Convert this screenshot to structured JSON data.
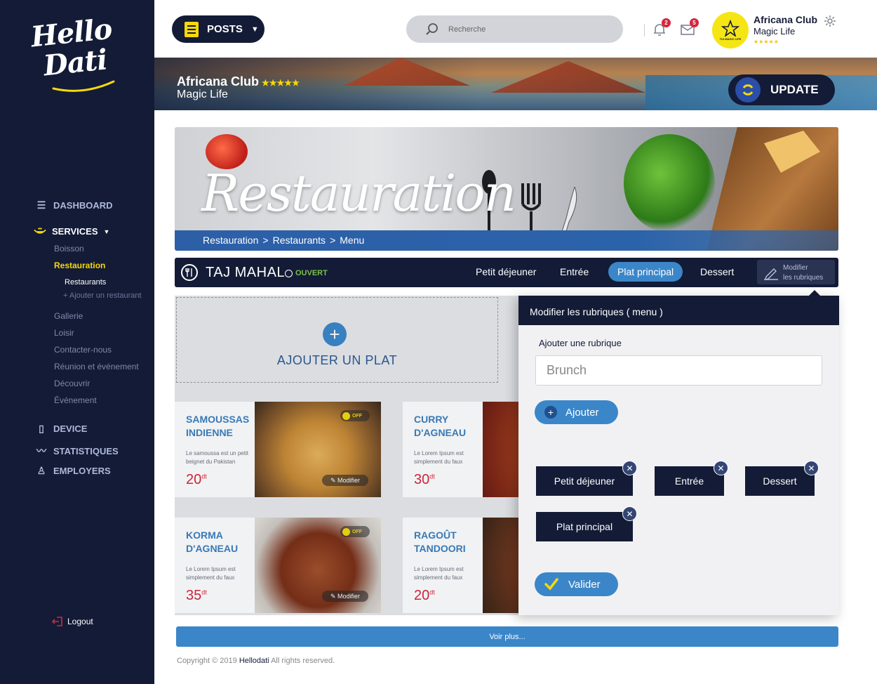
{
  "sidebar": {
    "logo_line1": "Hello",
    "logo_line2": "Dati",
    "nav": {
      "dashboard": "DASHBOARD",
      "services": "SERVICES",
      "boisson": "Boisson",
      "restauration": "Restauration",
      "restaurants": "Restaurants",
      "add_restaurant": "+ Ajouter un restaurant",
      "gallerie": "Gallerie",
      "loisir": "Loisir",
      "contact": "Contacter-nous",
      "reunion": "Réunion et événement",
      "decouvrir": "Découvrir",
      "evenement": "Événement",
      "device": "DEVICE",
      "statistiques": "STATISTIQUES",
      "employers": "EMPLOYERS"
    },
    "logout": "Logout"
  },
  "topbar": {
    "posts_label": "POSTS",
    "search_placeholder": "Recherche",
    "notifications_count": "2",
    "messages_count": "5",
    "avatar_text": "TUI MAGIC LIFE",
    "club_name": "Africana Club",
    "club_sub": "Magic Life",
    "club_stars": "★★★★★"
  },
  "hero": {
    "title": "Africana Club",
    "stars": "★★★★★",
    "subtitle": "Magic Life",
    "update_label": "UPDATE"
  },
  "banner": {
    "title": "Restauration",
    "breadcrumb": [
      "Restauration",
      ">",
      "Restaurants",
      ">",
      "Menu"
    ]
  },
  "restaurant": {
    "name": "TAJ MAHAL",
    "status": "OUVERT",
    "tabs": [
      "Petit déjeuner",
      "Entrée",
      "Plat principal",
      "Dessert"
    ],
    "active_tab": "Plat principal",
    "edit_label_1": "Modifier",
    "edit_label_2": "les rubriques"
  },
  "content": {
    "add_label": "AJOUTER UN PLAT",
    "dishes": [
      {
        "name": "SAMOUSSAS INDIENNE",
        "desc": "Le samoussa est un petit beignet du Pakistan",
        "price": "20",
        "currency": "dt",
        "badge": "OFF",
        "edit": "Modifier"
      },
      {
        "name": "CURRY D'AGNEAU",
        "desc": "Le Lorem Ipsum est simplement du faux",
        "price": "30",
        "currency": "dt"
      },
      {
        "name": "KORMA D'AGNEAU",
        "desc": "Le Lorem Ipsum est simplement du faux",
        "price": "35",
        "currency": "dt",
        "badge": "OFF",
        "edit": "Modifier"
      },
      {
        "name": "RAGOÛT TANDOORI",
        "desc": "Le Lorem Ipsum est simplement du faux",
        "price": "20",
        "currency": "dt"
      }
    ]
  },
  "panel": {
    "title": "Modifier les rubriques ( menu )",
    "add_label": "Ajouter une rubrique",
    "input_placeholder": "Brunch",
    "add_button": "Ajouter",
    "chips": [
      "Petit déjeuner",
      "Entrée",
      "Dessert",
      "Plat principal"
    ],
    "validate_button": "Valider"
  },
  "footer": {
    "voir_plus": "Voir plus...",
    "copyright_prefix": "Copyright © 2019",
    "brand": "Hellodati",
    "copyright_suffix": "All rights reserved."
  },
  "colors": {
    "navy": "#131b36",
    "accent_yellow": "#f5d90a",
    "accent_blue": "#3b86c9",
    "status_green": "#7cc04a",
    "price_red": "#d7263d"
  }
}
